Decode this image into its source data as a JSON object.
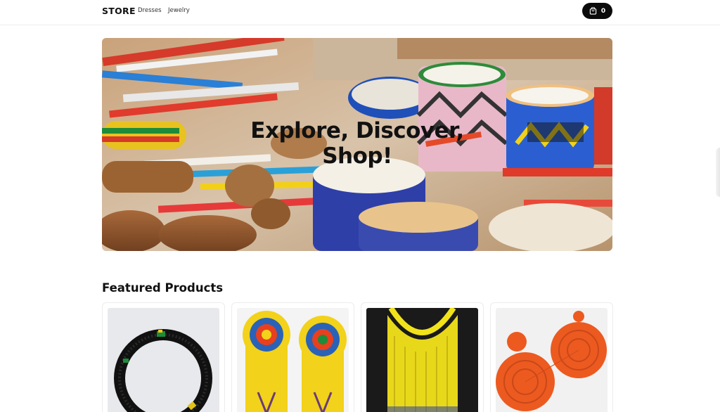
{
  "header": {
    "brand": "STORE",
    "nav": [
      "Dresses",
      "Jewelry"
    ],
    "cart_count": "0",
    "cart_icon": "shopping-bag-icon"
  },
  "hero": {
    "title_line1": "Explore, Discover,",
    "title_line2": "Shop!"
  },
  "featured": {
    "title": "Featured Products"
  },
  "colors": {
    "cart_bg": "#0b0b0b",
    "text": "#111111",
    "border": "#ececec"
  }
}
